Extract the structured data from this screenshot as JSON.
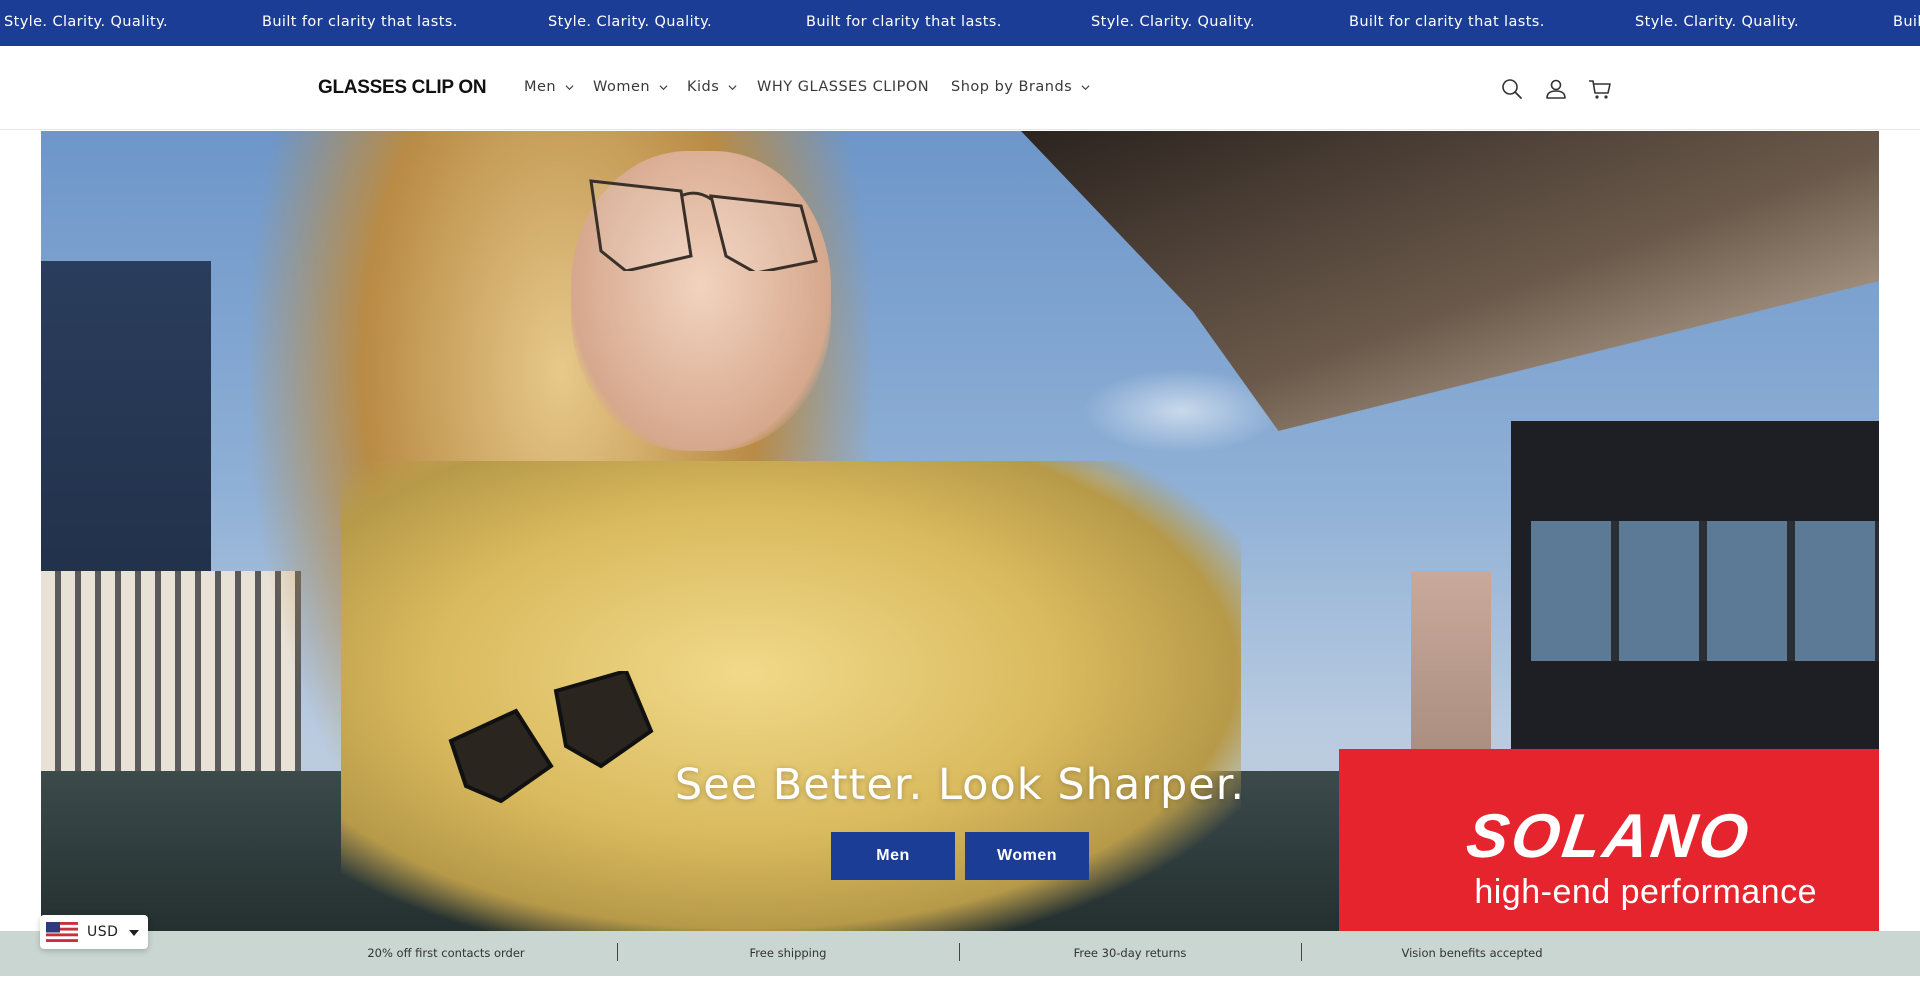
{
  "announcement": {
    "items": [
      "Style. Clarity. Quality.",
      "Built for clarity that lasts.",
      "Style. Clarity. Quality.",
      "Built for clarity that lasts.",
      "Style. Clarity. Quality.",
      "Built for clarity that lasts.",
      "Style. Clarity. Quality.",
      "Buil"
    ]
  },
  "header": {
    "logo": "GLASSES CLIP ON",
    "nav": [
      {
        "label": "Men",
        "has_dropdown": true
      },
      {
        "label": "Women",
        "has_dropdown": true
      },
      {
        "label": "Kids",
        "has_dropdown": true
      },
      {
        "label": "WHY GLASSES CLIPON",
        "has_dropdown": false
      },
      {
        "label": "Shop by Brands",
        "has_dropdown": true
      }
    ],
    "icons": [
      "search-icon",
      "account-icon",
      "cart-icon"
    ]
  },
  "hero": {
    "title": "See Better. Look Sharper.",
    "buttons": [
      "Men",
      "Women"
    ],
    "banner": {
      "brand": "SOLANO",
      "tagline": "high-end performance"
    }
  },
  "benefits": [
    "20% off first contacts order",
    "Free shipping",
    "Free 30-day returns",
    "Vision benefits accepted"
  ],
  "currency": {
    "code": "USD",
    "flag": "us-flag-icon"
  },
  "colors": {
    "brand_blue": "#1b3d96",
    "benefits_bg": "#c9d6d2",
    "solano_red": "#e6242e"
  }
}
